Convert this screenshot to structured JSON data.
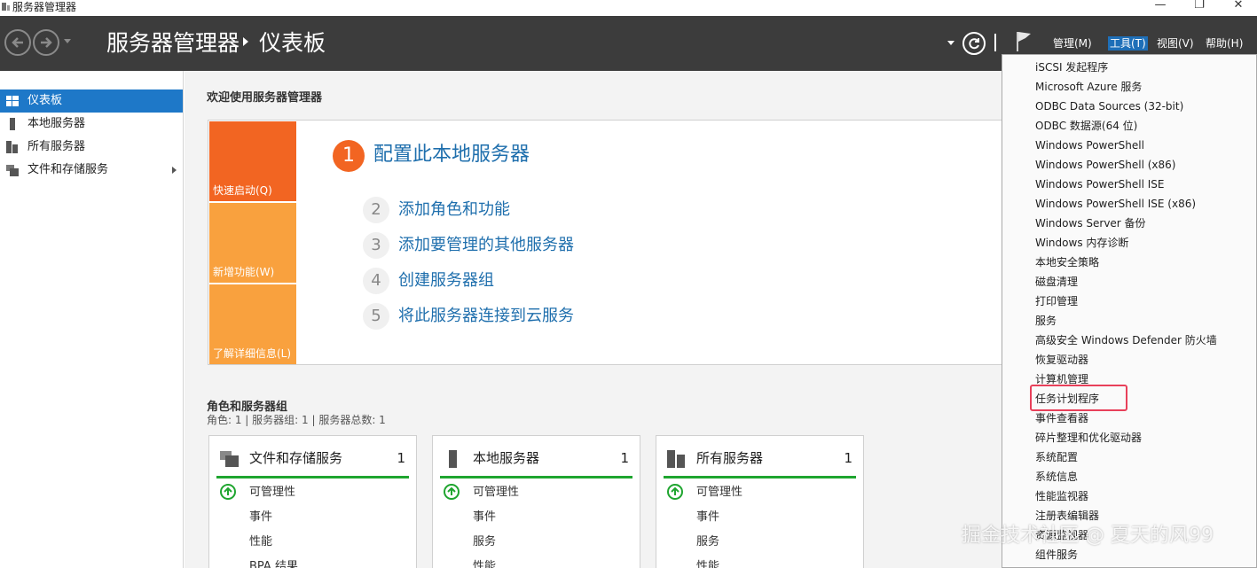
{
  "window": {
    "title": "服务器管理器",
    "minimize": "—",
    "maximize": "❐",
    "close": "✕"
  },
  "header": {
    "app_title": "服务器管理器",
    "page_title": "仪表板",
    "menus": {
      "manage": "管理(M)",
      "tools": "工具(T)",
      "view": "视图(V)",
      "help": "帮助(H)"
    }
  },
  "sidebar": {
    "items": [
      {
        "label": "仪表板",
        "icon": "dashboard-icon",
        "active": true
      },
      {
        "label": "本地服务器",
        "icon": "server-icon"
      },
      {
        "label": "所有服务器",
        "icon": "servers-icon"
      },
      {
        "label": "文件和存储服务",
        "icon": "storage-icon",
        "has_children": true
      }
    ]
  },
  "welcome": {
    "heading": "欢迎使用服务器管理器",
    "tiles": [
      "快速启动(Q)",
      "新增功能(W)",
      "了解详细信息(L)"
    ],
    "steps": [
      {
        "num": "1",
        "label": "配置此本地服务器"
      },
      {
        "num": "2",
        "label": "添加角色和功能"
      },
      {
        "num": "3",
        "label": "添加要管理的其他服务器"
      },
      {
        "num": "4",
        "label": "创建服务器组"
      },
      {
        "num": "5",
        "label": "将此服务器连接到云服务"
      }
    ]
  },
  "roles": {
    "heading": "角色和服务器组",
    "summary": "角色: 1 | 服务器组: 1 | 服务器总数: 1",
    "cards": [
      {
        "title": "文件和存储服务",
        "count": "1",
        "rows": [
          "可管理性",
          "事件",
          "性能",
          "BPA 结果"
        ]
      },
      {
        "title": "本地服务器",
        "count": "1",
        "rows": [
          "可管理性",
          "事件",
          "服务",
          "性能"
        ]
      },
      {
        "title": "所有服务器",
        "count": "1",
        "rows": [
          "可管理性",
          "事件",
          "服务",
          "性能"
        ]
      }
    ]
  },
  "tools_menu": {
    "items": [
      "iSCSI 发起程序",
      "Microsoft Azure 服务",
      "ODBC Data Sources (32-bit)",
      "ODBC 数据源(64 位)",
      "Windows PowerShell",
      "Windows PowerShell (x86)",
      "Windows PowerShell ISE",
      "Windows PowerShell ISE (x86)",
      "Windows Server 备份",
      "Windows 内存诊断",
      "本地安全策略",
      "磁盘清理",
      "打印管理",
      "服务",
      "高级安全 Windows Defender 防火墙",
      "恢复驱动器",
      "计算机管理",
      "任务计划程序",
      "事件查看器",
      "碎片整理和优化驱动器",
      "系统配置",
      "系统信息",
      "性能监视器",
      "注册表编辑器",
      "资源监视器",
      "组件服务"
    ],
    "highlighted": "任务计划程序",
    "highlight_color": "#e8405a"
  },
  "watermark": "掘金技术社区 @ 夏天的风99",
  "colors": {
    "header_bg": "#3c3c3c",
    "accent": "#1e78c8",
    "quick_start": "#f26522",
    "tile": "#f9a13e",
    "link": "#1f6fad",
    "ok_green": "#1fa52f"
  }
}
